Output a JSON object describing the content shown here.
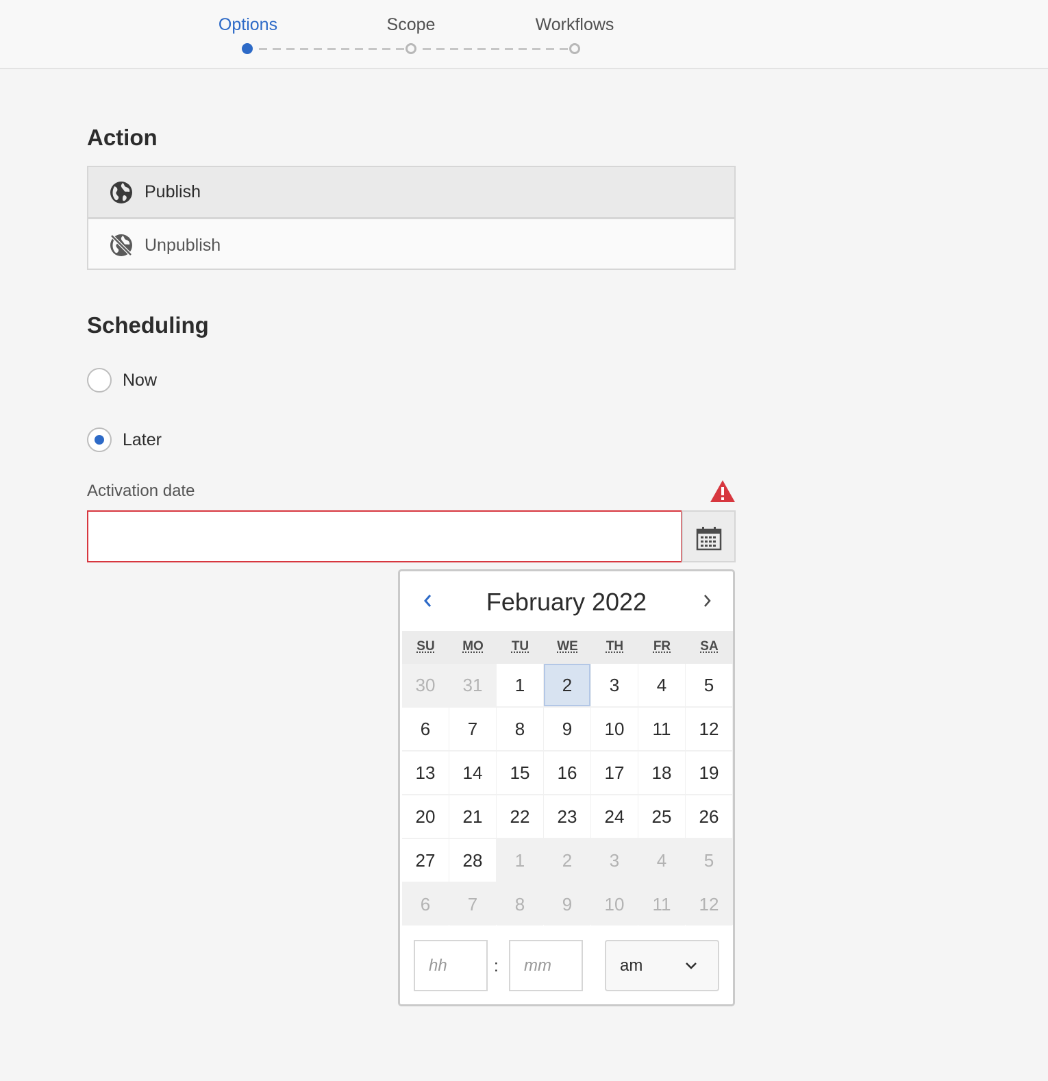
{
  "steps": {
    "options": "Options",
    "scope": "Scope",
    "workflows": "Workflows"
  },
  "action": {
    "title": "Action",
    "items": [
      {
        "label": "Publish",
        "icon": "globe-icon",
        "selected": true
      },
      {
        "label": "Unpublish",
        "icon": "globe-off-icon",
        "selected": false
      }
    ]
  },
  "scheduling": {
    "title": "Scheduling",
    "options": [
      {
        "label": "Now",
        "checked": false
      },
      {
        "label": "Later",
        "checked": true
      }
    ]
  },
  "activation": {
    "label": "Activation date",
    "value": "",
    "error_icon": "alert-icon",
    "calendar_icon": "calendar-icon"
  },
  "calendar": {
    "month_title": "February 2022",
    "weekdays": [
      "SU",
      "MO",
      "TU",
      "WE",
      "TH",
      "FR",
      "SA"
    ],
    "days": [
      [
        "30",
        "31",
        "1",
        "2",
        "3",
        "4",
        "5"
      ],
      [
        "6",
        "7",
        "8",
        "9",
        "10",
        "11",
        "12"
      ],
      [
        "13",
        "14",
        "15",
        "16",
        "17",
        "18",
        "19"
      ],
      [
        "20",
        "21",
        "22",
        "23",
        "24",
        "25",
        "26"
      ],
      [
        "27",
        "28",
        "1",
        "2",
        "3",
        "4",
        "5"
      ],
      [
        "6",
        "7",
        "8",
        "9",
        "10",
        "11",
        "12"
      ]
    ],
    "today": "2",
    "hour_placeholder": "hh",
    "minute_placeholder": "mm",
    "separator": ":",
    "meridiem": "am"
  },
  "colors": {
    "accent": "#2d6ac7",
    "error": "#d7373f"
  }
}
